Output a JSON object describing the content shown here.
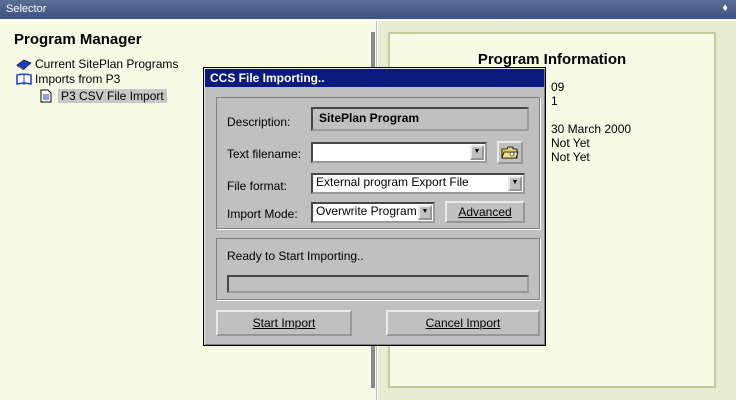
{
  "window": {
    "title": "Selector",
    "pin_glyph": "♦"
  },
  "left": {
    "title": "Program Manager",
    "tree": [
      {
        "label": "Current SitePlan Programs",
        "icon": "book-icon"
      },
      {
        "label": "Imports from P3",
        "icon": "open-book-icon"
      },
      {
        "label": "P3 CSV File Import",
        "icon": "document-icon",
        "selected": true
      }
    ]
  },
  "right": {
    "title": "Program Information",
    "values": [
      "09",
      "1",
      "30 March 2000",
      "Not Yet",
      "Not Yet"
    ]
  },
  "dialog": {
    "title": "CCS File Importing..",
    "description_label": "Description:",
    "description_value": "SitePlan Program",
    "text_filename_label": "Text filename:",
    "text_filename_value": "",
    "file_format_label": "File format:",
    "file_format_value": "External program Export File",
    "import_mode_label": "Import Mode:",
    "import_mode_value": "Overwrite Program",
    "advanced_button": "Advanced",
    "status_text": "Ready to Start Importing..",
    "progress": 0,
    "start_button": "Start Import",
    "cancel_button": "Cancel Import",
    "browse_icon": "folder-browse-icon"
  }
}
